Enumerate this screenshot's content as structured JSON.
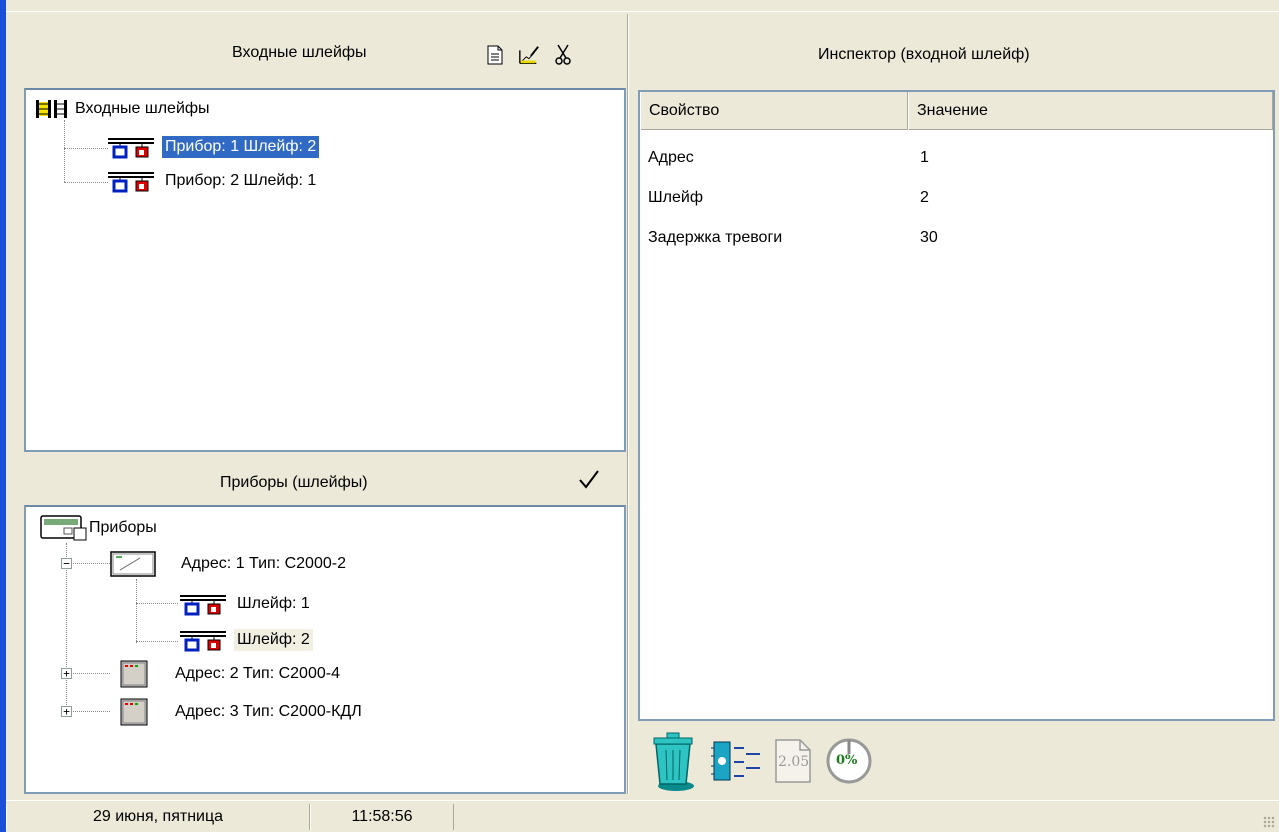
{
  "input_loops_panel": {
    "title": "Входные шлейфы",
    "toolbar": {
      "new_icon": "document-icon",
      "edit_icon": "edit-chart-icon",
      "cut_icon": "scissors-icon"
    },
    "tree": {
      "root_label": "Входные шлейфы",
      "items": [
        {
          "label": "Прибор: 1 Шлейф: 2",
          "selected": true
        },
        {
          "label": "Прибор: 2 Шлейф: 1",
          "selected": false
        }
      ]
    }
  },
  "devices_panel": {
    "title": "Приборы  (шлейфы)",
    "apply_icon": "checkmark-icon",
    "tree": {
      "root_label": "Приборы",
      "devices": [
        {
          "label": "Адрес: 1 Тип: С2000-2",
          "expanded": true,
          "loops": [
            {
              "label": "Шлейф: 1"
            },
            {
              "label": "Шлейф: 2",
              "highlighted": true
            }
          ]
        },
        {
          "label": "Адрес: 2 Тип: С2000-4",
          "expanded": false
        },
        {
          "label": "Адрес: 3 Тип: С2000-КДЛ",
          "expanded": false
        }
      ]
    }
  },
  "inspector": {
    "title": "Инспектор (входной шлейф)",
    "columns": [
      "Свойство",
      "Значение"
    ],
    "rows": [
      {
        "property": "Адрес",
        "value": "1"
      },
      {
        "property": "Шлейф",
        "value": "2"
      },
      {
        "property": "Задержка тревоги",
        "value": "30"
      }
    ],
    "actions": {
      "delete_icon": "trash-icon",
      "chip_icon": "chip-transfer-icon",
      "version_label": "2.05",
      "progress_label": "0%",
      "progress": 0
    }
  },
  "statusbar": {
    "date": "29 июня, пятница",
    "time": "11:58:56"
  },
  "colors": {
    "accent": "#1a4fd8",
    "selection": "#316ac5",
    "border": "#7f9db9",
    "face": "#ece9d8"
  }
}
